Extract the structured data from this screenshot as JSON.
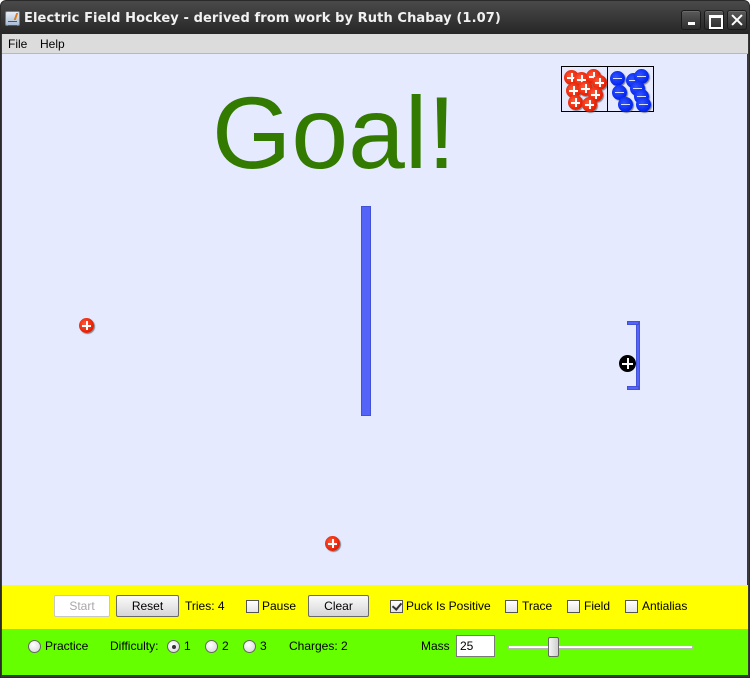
{
  "window": {
    "title": "Electric Field Hockey - derived from work by Ruth Chabay (1.07)",
    "controls": [
      "minimize",
      "maximize",
      "close"
    ]
  },
  "menubar": {
    "items": [
      {
        "label": "File"
      },
      {
        "label": "Help"
      }
    ]
  },
  "canvas": {
    "background_color": "#e5eaff",
    "status_message": "Goal!",
    "status_color": "#337a00",
    "charge_bins": {
      "positive": {
        "label": "positive-charge-bin",
        "count": 9,
        "symbol": "+",
        "color": "#e41b00"
      },
      "negative": {
        "label": "negative-charge-bin",
        "count": 8,
        "symbol": "−",
        "color": "#0022ee"
      }
    },
    "placed_charges": [
      {
        "sign": "positive",
        "symbol": "+"
      },
      {
        "sign": "positive",
        "symbol": "+"
      }
    ],
    "puck": {
      "sign": "positive",
      "symbol": "+",
      "color": "#000000"
    },
    "barrier_color": "#5463f8"
  },
  "controls_top": {
    "background": "#ffff00",
    "start_label": "Start",
    "start_enabled": false,
    "reset_label": "Reset",
    "tries_label": "Tries:",
    "tries_value": "4",
    "tries_text": "Tries: 4",
    "pause": {
      "label": "Pause",
      "checked": false
    },
    "clear_label": "Clear",
    "puck_positive": {
      "label": "Puck Is Positive",
      "checked": true
    },
    "trace": {
      "label": "Trace",
      "checked": false
    },
    "field": {
      "label": "Field",
      "checked": false
    },
    "antialias": {
      "label": "Antialias",
      "checked": false
    }
  },
  "controls_bottom": {
    "background": "#66ff00",
    "practice": {
      "label": "Practice",
      "selected": false
    },
    "difficulty_label": "Difficulty:",
    "difficulty_options": [
      {
        "label": "1",
        "selected": true
      },
      {
        "label": "2",
        "selected": false
      },
      {
        "label": "3",
        "selected": false
      }
    ],
    "charges_text": "Charges: 2",
    "mass_label": "Mass",
    "mass_value": "25",
    "mass_slider_fraction": 0.23
  }
}
